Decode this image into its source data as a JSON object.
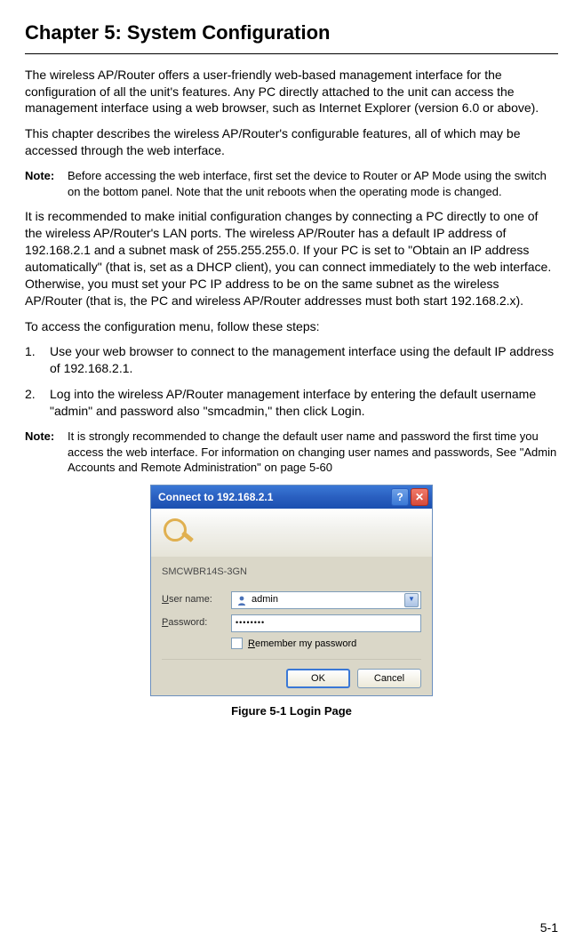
{
  "chapter": {
    "title": "Chapter 5: System Configuration"
  },
  "paragraphs": {
    "p1": "The wireless AP/Router offers a user-friendly web-based management interface for the configuration of all the unit's features. Any PC directly attached to the unit can access the management interface using a web browser, such as Internet Explorer (version 6.0 or above).",
    "p2": "This chapter describes the wireless AP/Router's configurable features, all of which may be accessed through the web interface.",
    "p3": "It is recommended to make initial configuration changes by connecting a PC directly to one of the wireless AP/Router's LAN ports. The wireless AP/Router has a default IP address of 192.168.2.1 and a subnet mask of 255.255.255.0. If your PC is set to \"Obtain an IP address automatically\" (that is, set as a DHCP client), you can connect immediately to the web interface. Otherwise, you must set your PC IP address to be on the same subnet as the wireless AP/Router (that is, the PC and wireless AP/Router addresses must both start 192.168.2.x).",
    "p4": "To access the configuration menu, follow these steps:"
  },
  "notes": {
    "label": "Note:",
    "n1": "Before accessing the web interface, first set the device to Router or AP Mode using the switch on the bottom panel. Note that the unit reboots when the operating mode is changed.",
    "n2": "It is strongly recommended to change the default user name and password the first time you access the web interface. For information on changing user names and passwords, See \"Admin Accounts and Remote Administration\" on page 5-60"
  },
  "steps": {
    "s1num": "1.",
    "s1": "Use your web browser to connect to the management interface using the default IP address of 192.168.2.1.",
    "s2num": "2.",
    "s2": "Log into the wireless AP/Router management interface by entering the default username \"admin\" and password also \"smcadmin,\" then click Login."
  },
  "dialog": {
    "title": "Connect to 192.168.2.1",
    "help": "?",
    "close": "✕",
    "realm": "SMCWBR14S-3GN",
    "username_label_pre": "U",
    "username_label_post": "ser name:",
    "username_value": "admin",
    "password_label_pre": "P",
    "password_label_post": "assword:",
    "password_value": "••••••••",
    "remember_pre": "R",
    "remember_post": "emember my password",
    "ok": "OK",
    "cancel": "Cancel"
  },
  "figure": {
    "caption": "Figure 5-1  Login Page"
  },
  "page": {
    "number": "5-1"
  }
}
